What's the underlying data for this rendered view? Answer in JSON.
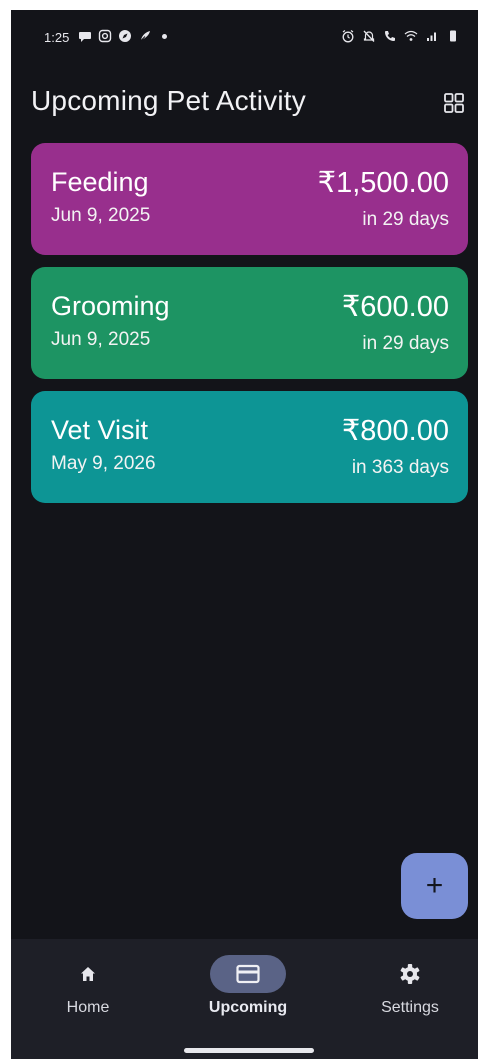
{
  "status_bar": {
    "time": "1:25",
    "left_icons": [
      "message-icon",
      "instagram-icon",
      "compass-icon",
      "feather-icon"
    ],
    "right_icons": [
      "alarm-icon",
      "mute-icon",
      "call-icon",
      "wifi-icon",
      "signal-icon",
      "battery-icon"
    ]
  },
  "header": {
    "title": "Upcoming Pet Activity",
    "action_icon": "grid-view-icon"
  },
  "activities": [
    {
      "name": "Feeding",
      "date": "Jun 9, 2025",
      "amount": "₹1,500.00",
      "due": "in 29 days",
      "color": "#982f8d"
    },
    {
      "name": "Grooming",
      "date": "Jun 9, 2025",
      "amount": "₹600.00",
      "due": "in 29 days",
      "color": "#1d9463"
    },
    {
      "name": "Vet Visit",
      "date": "May 9, 2026",
      "amount": "₹800.00",
      "due": "in 363 days",
      "color": "#0d9595"
    }
  ],
  "fab": {
    "label": "+",
    "color": "#7a8fd6"
  },
  "bottom_nav": {
    "items": [
      {
        "label": "Home",
        "icon": "home-icon",
        "active": false
      },
      {
        "label": "Upcoming",
        "icon": "card-icon",
        "active": true
      },
      {
        "label": "Settings",
        "icon": "gear-icon",
        "active": false
      }
    ]
  },
  "theme": {
    "background": "#131419",
    "nav_background": "#1e1f27",
    "nav_active_pill": "#5a6386"
  }
}
